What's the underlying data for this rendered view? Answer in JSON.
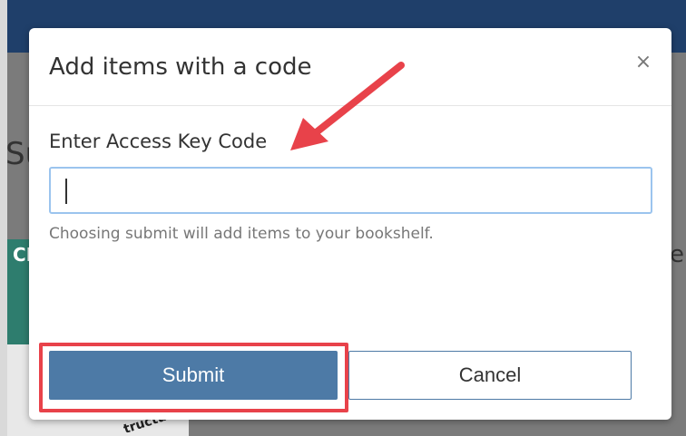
{
  "background": {
    "heading_fragment": "Su",
    "cover_text": "CMS",
    "cover_word": "tructures",
    "right_char": "e"
  },
  "modal": {
    "title": "Add items with a code",
    "close_symbol": "×",
    "field_label": "Enter Access Key Code",
    "input_value": "",
    "input_placeholder": "",
    "help_text": "Choosing submit will add items to your bookshelf.",
    "submit_label": "Submit",
    "cancel_label": "Cancel"
  },
  "annotations": {
    "arrow_color": "#e8424a",
    "highlight_color": "#e8424a"
  },
  "colors": {
    "header": "#1f3f6a",
    "primary_button": "#4d7aa6",
    "input_focus_border": "#9bc4ee"
  }
}
